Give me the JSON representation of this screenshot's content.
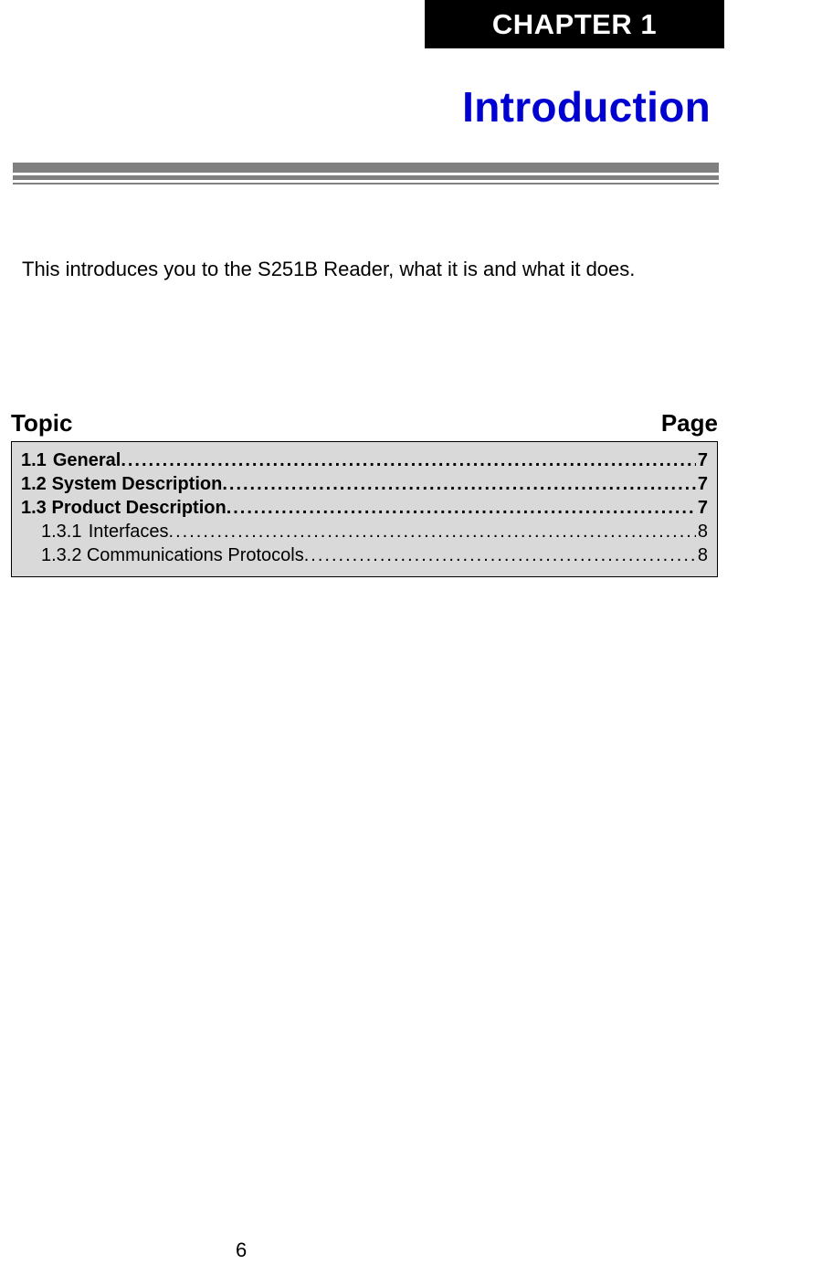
{
  "chapter_label": "CHAPTER 1",
  "title": "Introduction",
  "intro": "This introduces you to the S251B Reader, what it is and what it does.",
  "toc_header": {
    "topic": "Topic",
    "page": "Page"
  },
  "toc": [
    {
      "num": "1.1",
      "title": "General",
      "page": "7",
      "level": 1
    },
    {
      "num": "1.2",
      "title": "System Description",
      "page": "7",
      "level": 1
    },
    {
      "num": "1.3",
      "title": "Product Description",
      "page": "7",
      "level": 1
    },
    {
      "num": "1.3.1",
      "title": "Interfaces ",
      "page": "8",
      "level": 2
    },
    {
      "num": "1.3.2",
      "title": "Communications Protocols ",
      "page": "8",
      "level": 2
    }
  ],
  "page_number": "6"
}
